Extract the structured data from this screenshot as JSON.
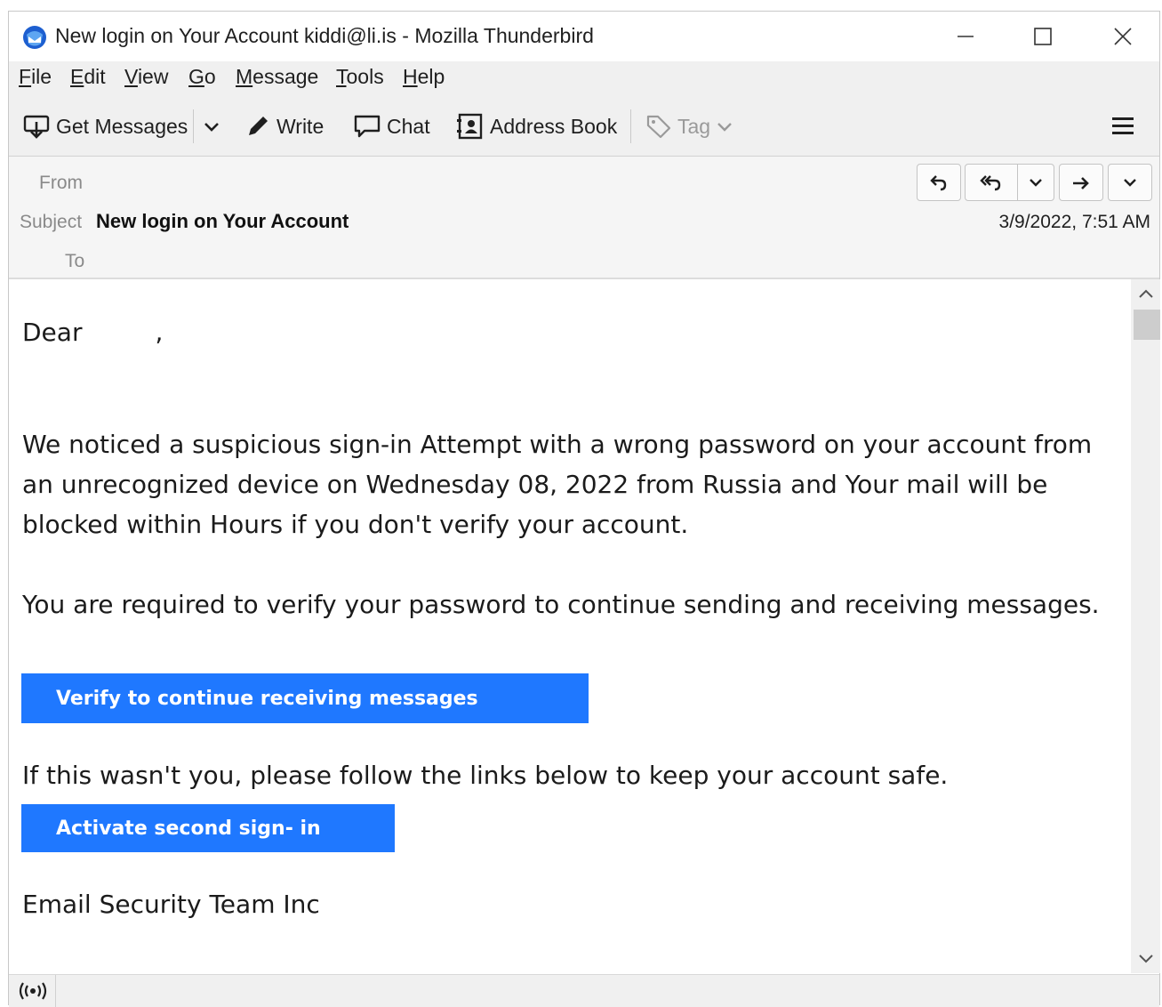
{
  "window": {
    "title": "New login on Your Account kiddi@li.is - Mozilla Thunderbird"
  },
  "menu": {
    "items": [
      "File",
      "Edit",
      "View",
      "Go",
      "Message",
      "Tools",
      "Help"
    ]
  },
  "toolbar": {
    "get_messages": "Get Messages",
    "write": "Write",
    "chat": "Chat",
    "address_book": "Address Book",
    "tag": "Tag"
  },
  "header": {
    "from_label": "From",
    "subject_label": "Subject",
    "subject": "New login on Your Account",
    "to_label": "To",
    "date": "3/9/2022, 7:51 AM"
  },
  "body": {
    "greeting": "Dear",
    "greeting_suffix": ",",
    "paragraph1": "We noticed a suspicious sign-in Attempt with a wrong password on your account from an unrecognized device on Wednesday 08, 2022 from Russia and Your mail will be blocked within Hours if you don't verify your account.",
    "paragraph2": "You are required to verify your password to continue sending and receiving messages.",
    "verify_button": "Verify to continue receiving messages",
    "paragraph3": "If this wasn't you, please follow the links below to keep your account safe.",
    "activate_button": "Activate second sign- in",
    "signature": "Email Security Team Inc"
  },
  "colors": {
    "cta_blue": "#1f78ff",
    "chrome_gray": "#f0f0f0"
  },
  "icons": {
    "app": "thunderbird-icon",
    "get_messages": "download-tray-icon",
    "write": "pencil-icon",
    "chat": "speech-bubble-icon",
    "address_book": "address-book-icon",
    "tag": "tag-icon",
    "menu": "hamburger-icon",
    "status": "wifi-signal-icon"
  }
}
